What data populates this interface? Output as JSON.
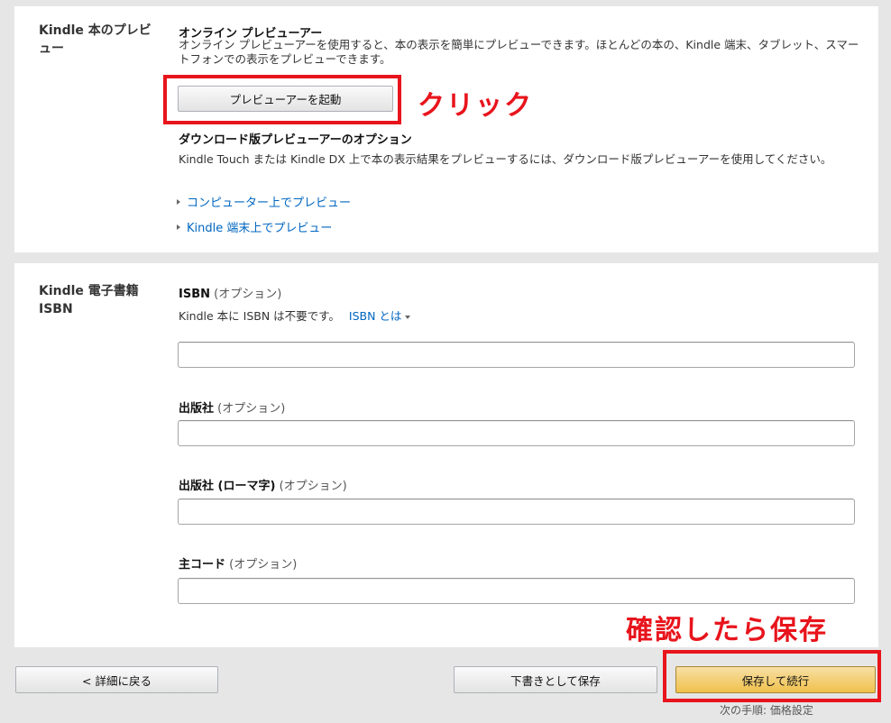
{
  "preview_section": {
    "label": "Kindle 本のプレビュー",
    "online_heading": "オンライン プレビューアー",
    "online_desc": "オンライン プレビューアーを使用すると、本の表示を簡単にプレビューできます。ほとんどの本の、Kindle 端末、タブレット、スマートフォンでの表示をプレビューできます。",
    "launch_button": "プレビューアーを起動",
    "download_heading": "ダウンロード版プレビューアーのオプション",
    "download_desc": "Kindle Touch または Kindle DX 上で本の表示結果をプレビューするには、ダウンロード版プレビューアーを使用してください。",
    "link_computer": "コンピューター上でプレビュー",
    "link_device": "Kindle 端末上でプレビュー"
  },
  "isbn_section": {
    "label": "Kindle 電子書籍 ISBN",
    "isbn_label": "ISBN",
    "optional": "(オプション)",
    "isbn_note": "Kindle 本に ISBN は不要です。",
    "isbn_link": "ISBN とは",
    "publisher_label": "出版社",
    "publisher_roman_label": "出版社 (ローマ字)",
    "primary_code_label": "主コード",
    "isbn_value": "",
    "publisher_value": "",
    "publisher_roman_value": "",
    "primary_code_value": ""
  },
  "footer": {
    "back_button": "< 詳細に戻る",
    "save_draft_button": "下書きとして保存",
    "save_continue_button": "保存して続行",
    "next_step": "次の手順: 価格設定"
  },
  "annotations": {
    "click_label": "クリック",
    "confirm_label": "確認したら保存",
    "color": "#e8141c"
  }
}
